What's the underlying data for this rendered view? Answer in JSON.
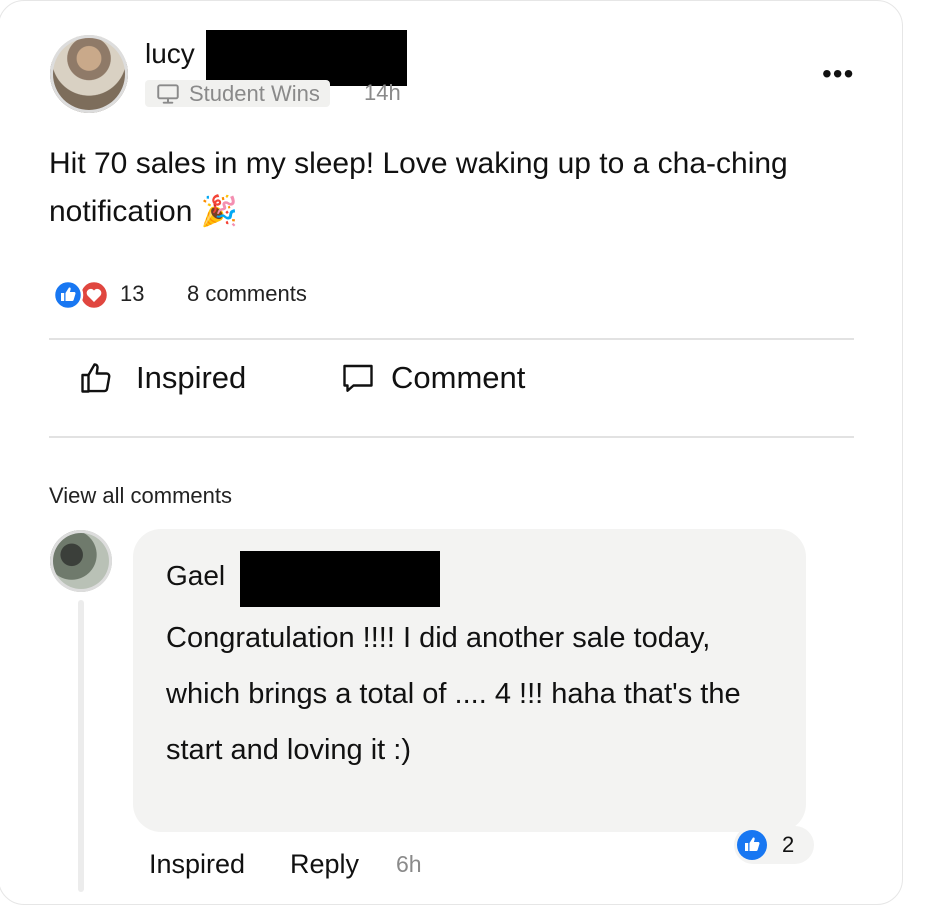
{
  "post": {
    "author": "lucy",
    "category": "Student Wins",
    "time": "14h",
    "text": "Hit 70 sales in my sleep! Love waking up to a cha-ching notification 🎉",
    "reaction_count": "13",
    "comments_label": "8 comments",
    "more_label": "•••"
  },
  "actions": {
    "inspired_label": "Inspired",
    "comment_label": "Comment"
  },
  "comments_section": {
    "view_all_label": "View all comments"
  },
  "comment": {
    "author": "Gael",
    "text": "Congratulation !!!! I did another sale today, which brings a total of .... 4 !!! haha that's the start and loving it :)",
    "like_count": "2",
    "inspired_label": "Inspired",
    "reply_label": "Reply",
    "time": "6h"
  },
  "colors": {
    "like_blue": "#1877f2",
    "love_red": "#e0463f",
    "muted_gray": "#8a8a8a"
  }
}
